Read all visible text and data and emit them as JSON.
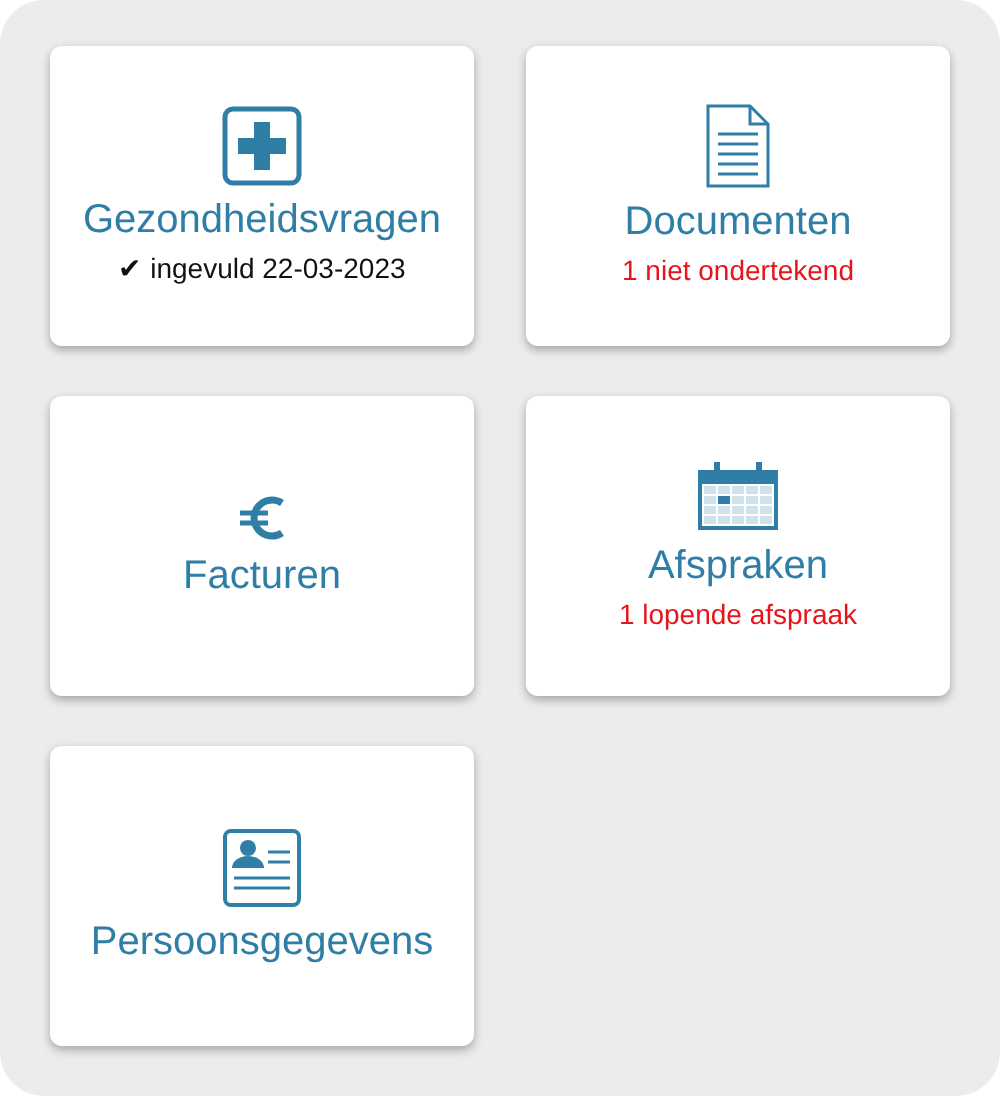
{
  "tiles": [
    {
      "kind": "plus",
      "title": "Gezondheidsvragen",
      "status": {
        "kind": "done",
        "text": "✔ ingevuld 22-03-2023"
      }
    },
    {
      "kind": "document",
      "title": "Documenten",
      "status": {
        "kind": "warning",
        "text": "1 niet ondertekend"
      }
    },
    {
      "kind": "euro",
      "title": "Facturen"
    },
    {
      "kind": "calendar",
      "title": "Afspraken",
      "status": {
        "kind": "warning",
        "text": "1 lopende afspraak"
      }
    },
    {
      "kind": "idcard",
      "title": "Persoonsgegevens"
    }
  ]
}
